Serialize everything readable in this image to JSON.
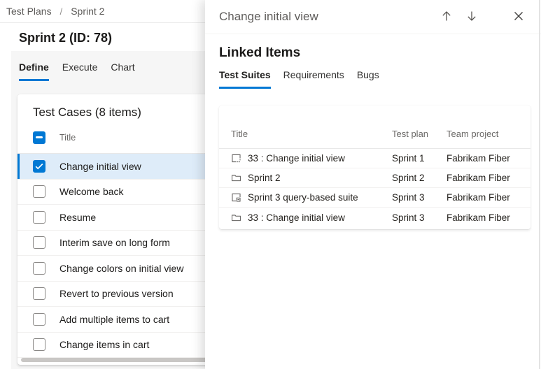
{
  "breadcrumb": {
    "items": [
      "Test Plans",
      "Sprint 2"
    ],
    "separator": "/"
  },
  "page_title": "Sprint 2 (ID: 78)",
  "tabs": {
    "items": [
      {
        "label": "Define",
        "active": true
      },
      {
        "label": "Execute",
        "active": false
      },
      {
        "label": "Chart",
        "active": false
      }
    ]
  },
  "test_cases": {
    "title": "Test Cases (8 items)",
    "column_header": "Title",
    "select_all_state": "indeterminate",
    "rows": [
      {
        "label": "Change initial view",
        "checked": true,
        "selected": true
      },
      {
        "label": "Welcome back",
        "checked": false,
        "selected": false
      },
      {
        "label": "Resume",
        "checked": false,
        "selected": false
      },
      {
        "label": "Interim save on long form",
        "checked": false,
        "selected": false
      },
      {
        "label": "Change colors on initial view",
        "checked": false,
        "selected": false
      },
      {
        "label": "Revert to previous version",
        "checked": false,
        "selected": false
      },
      {
        "label": "Add multiple items to cart",
        "checked": false,
        "selected": false
      },
      {
        "label": "Change items in cart",
        "checked": false,
        "selected": false
      }
    ]
  },
  "panel": {
    "title": "Change initial view",
    "header_icons": [
      "arrow-up-icon",
      "arrow-down-icon",
      "close-icon"
    ],
    "section_title": "Linked Items",
    "tabs": [
      {
        "label": "Test Suites",
        "active": true
      },
      {
        "label": "Requirements",
        "active": false
      },
      {
        "label": "Bugs",
        "active": false
      }
    ],
    "table": {
      "columns": [
        "Title",
        "Test plan",
        "Team project"
      ],
      "rows": [
        {
          "icon": "requirement-suite-icon",
          "title": "33 : Change initial view",
          "test_plan": "Sprint 1",
          "team_project": "Fabrikam Fiber"
        },
        {
          "icon": "static-suite-icon",
          "title": "Sprint 2",
          "test_plan": "Sprint 2",
          "team_project": "Fabrikam Fiber"
        },
        {
          "icon": "query-suite-icon",
          "title": "Sprint 3 query-based suite",
          "test_plan": "Sprint 3",
          "team_project": "Fabrikam Fiber"
        },
        {
          "icon": "static-suite-icon",
          "title": "33 : Change initial view",
          "test_plan": "Sprint 3",
          "team_project": "Fabrikam Fiber"
        }
      ]
    }
  },
  "colors": {
    "accent": "#0078d4",
    "selected_row_bg": "#deecf9",
    "text_primary": "#201f1e",
    "text_secondary": "#605e5c",
    "divider": "#eaeaea",
    "page_bg": "#f6f6f6"
  }
}
